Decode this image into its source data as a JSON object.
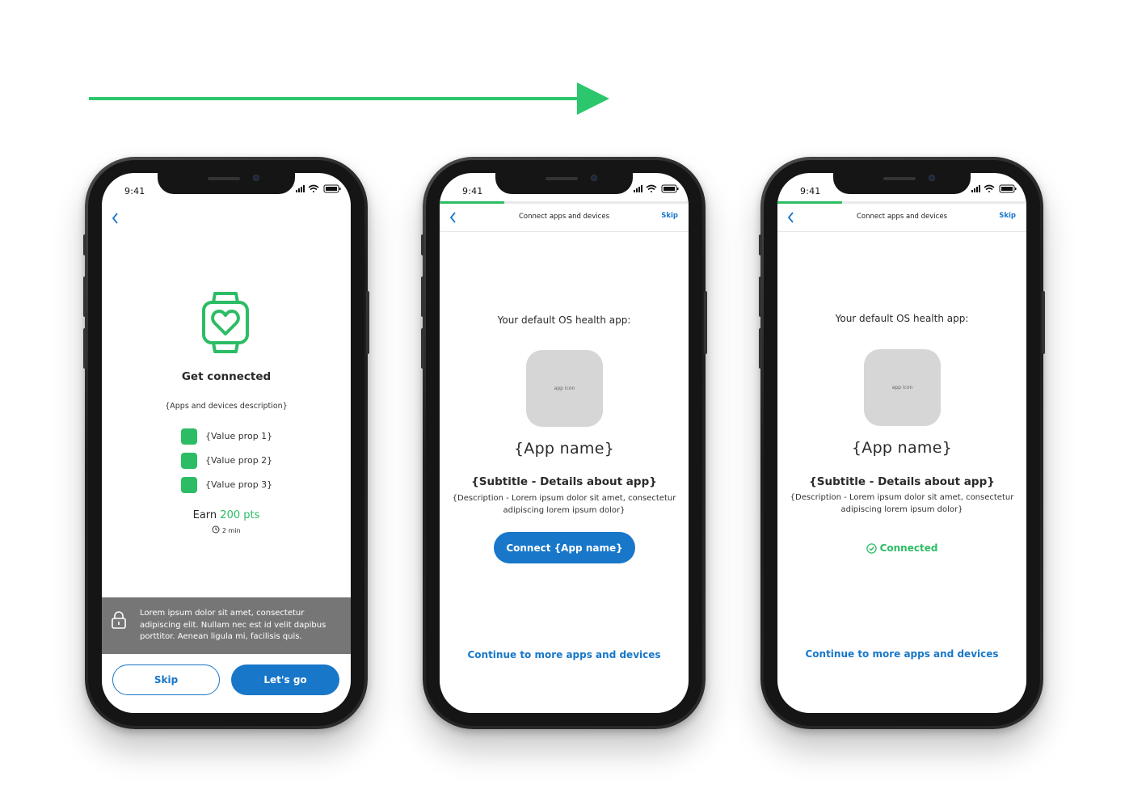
{
  "flow": {
    "arrow_color": "#2cc76c"
  },
  "colors": {
    "accent_green": "#2cbd64",
    "link_blue": "#1877c9",
    "banner_grey": "#767676"
  },
  "status_bar": {
    "time": "9:41",
    "icons": [
      "signal-icon",
      "wifi-icon",
      "battery-icon"
    ]
  },
  "screen1": {
    "title": "Get connected",
    "description": "{Apps and devices description}",
    "value_props": [
      "{Value prop 1}",
      "{Value prop 2}",
      "{Value prop 3}"
    ],
    "earn_prefix": "Earn",
    "earn_points": "200 pts",
    "time_estimate": "2 min",
    "privacy_text": "Lorem ipsum dolor sit amet, consectetur adipiscing elit. Nullam nec est id velit dapibus porttitor. Aenean ligula mi, facilisis quis.",
    "skip_label": "Skip",
    "go_label": "Let's go"
  },
  "screen2": {
    "nav_title": "Connect apps and devices",
    "skip_label": "Skip",
    "progress": 0.26,
    "section_label": "Your default OS health app:",
    "app_icon_label": "app icon",
    "app_name": "{App name}",
    "subtitle": "{Subtitle - Details about app}",
    "description": "{Description - Lorem ipsum dolor sit amet, consectetur adipiscing lorem ipsum dolor}",
    "connect_label": "Connect {App name}",
    "continue_label": "Continue to more apps and devices"
  },
  "screen3": {
    "nav_title": "Connect apps and devices",
    "skip_label": "Skip",
    "progress": 0.26,
    "section_label": "Your default OS health app:",
    "app_icon_label": "app icon",
    "app_name": "{App name}",
    "subtitle": "{Subtitle - Details about app}",
    "description": "{Description - Lorem ipsum dolor sit amet, consectetur adipiscing lorem ipsum dolor}",
    "connected_label": "Connected",
    "continue_label": "Continue to more apps and devices"
  }
}
